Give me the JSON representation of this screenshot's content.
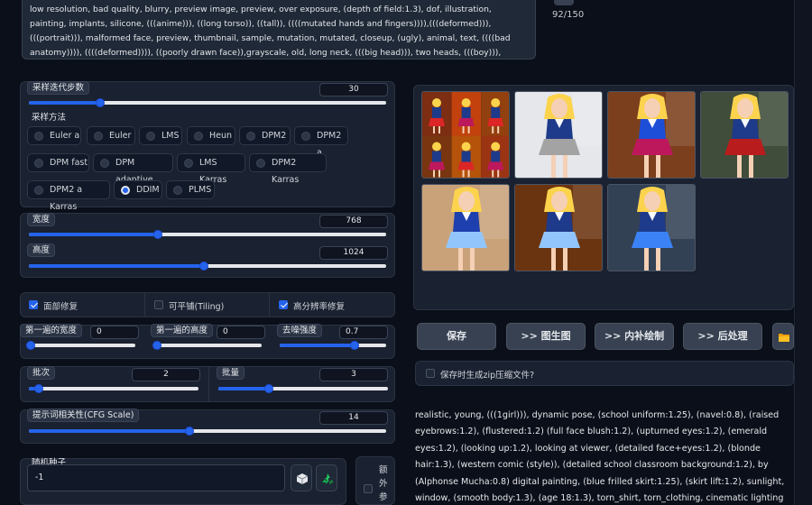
{
  "negative_prompt": {
    "text": "low resolution, bad quality, blurry, preview image, preview, over exposure, (depth of field:1.3), dof, illustration, painting, implants, silicone, (((anime))), ((long torso)), ((tall)), ((((mutated hands and fingers)))),(((deformed))), (((portrait))), malformed face, preview, thumbnail, sample, mutation, mutated, closeup, (ugly), animal, text, ((((bad anatomy)))), ((((deformed)))), ((poorly drawn face)),grayscale, old, long neck, (((big head))), two heads, (((boy))), (((amputated))), (((big eyes)))",
    "token_count": "92/150"
  },
  "sampling_steps": {
    "label": "采样迭代步数",
    "value": "30",
    "fraction": 0.2
  },
  "sampler": {
    "label": "采样方法",
    "options": [
      "Euler a",
      "Euler",
      "LMS",
      "Heun",
      "DPM2",
      "DPM2 a",
      "DPM fast",
      "DPM adaptive",
      "LMS Karras",
      "DPM2 Karras",
      "DPM2 a Karras",
      "DDIM",
      "PLMS"
    ],
    "selected": "DDIM"
  },
  "width": {
    "label": "宽度",
    "value": "768",
    "fraction": 0.333
  },
  "height": {
    "label": "高度",
    "value": "1024",
    "fraction": 0.467
  },
  "checkboxes": [
    {
      "label": "面部修复",
      "checked": true
    },
    {
      "label": "可平铺(Tiling)",
      "checked": false
    },
    {
      "label": "高分辨率修复",
      "checked": true
    }
  ],
  "firstpass_width": {
    "label": "第一遍的宽度",
    "value": "0",
    "fraction": 0
  },
  "firstpass_height": {
    "label": "第一遍的高度",
    "value": "0",
    "fraction": 0
  },
  "denoise": {
    "label": "去噪强度",
    "value": "0.7",
    "fraction": 0.7
  },
  "batch_count": {
    "label": "批次",
    "value": "2",
    "fraction": 0.06
  },
  "batch_size": {
    "label": "批量",
    "value": "3",
    "fraction": 0.3
  },
  "cfg_scale": {
    "label": "提示词相关性(CFG Scale)",
    "value": "14",
    "fraction": 0.43
  },
  "seed": {
    "label": "随机种子",
    "value": "-1",
    "extra_label": "额外参"
  },
  "gallery": {
    "image_count": 9
  },
  "actions": {
    "save": "保存",
    "img2img": ">> 图生图",
    "inpaint": ">> 内补绘制",
    "extras": ">> 后处理",
    "zip_label": "保存时生成zip压缩文件?"
  },
  "output_text": "realistic, young, (((1girl))), dynamic pose, (school uniform:1.25), (navel:0.8), (raised eyebrows:1.2), (flustered:1.2) (full face blush:1.2), (upturned eyes:1.2), (emerald eyes:1.2), (looking up:1.2), looking at viewer, (detailed face+eyes:1.2), (blonde hair:1.3), (western comic (style)), (detailed school classroom background:1.2), by (Alphonse Mucha:0.8) digital painting, (blue frilled skirt:1.25), (skirt lift:1.2), sunlight, window, (smooth body:1.3), (age 18:1.3), torn_shirt, torn_clothing, cinematic lighting",
  "colors": {
    "accent": "#2563eb",
    "background": "#0b0f19",
    "panel": "#1a2130"
  }
}
